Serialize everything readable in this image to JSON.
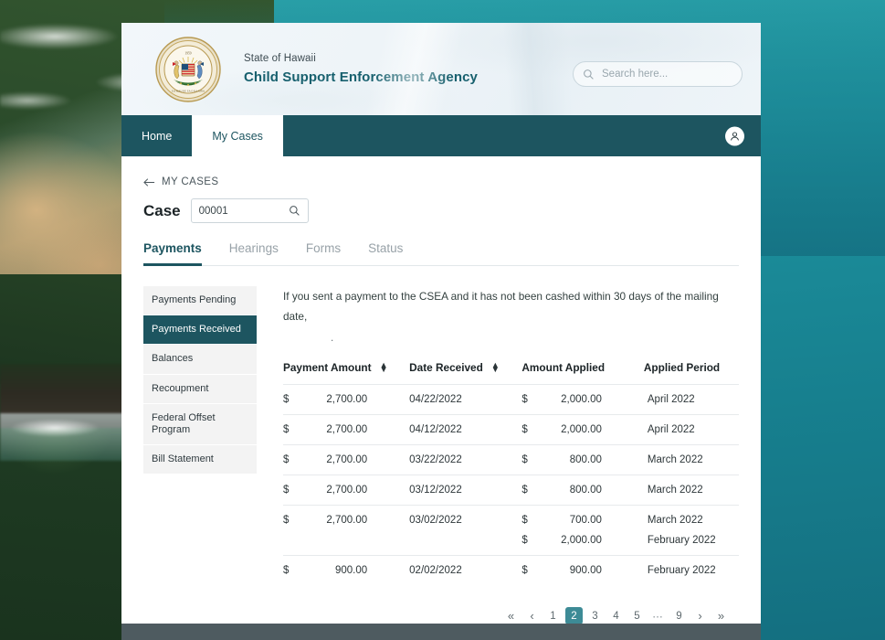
{
  "masthead": {
    "seal_icon": "hawaii-state-seal",
    "agency_state": "State of Hawaii",
    "agency_name": "Child Support Enforcement Agency",
    "search_placeholder": "Search here...",
    "search_icon": "search-icon"
  },
  "navbar": {
    "items": [
      {
        "label": "Home",
        "active": false
      },
      {
        "label": "My Cases",
        "active": true
      }
    ],
    "avatar_icon": "user-avatar-icon"
  },
  "breadcrumb": {
    "back_icon": "arrow-left-icon",
    "label": "MY CASES"
  },
  "case": {
    "label": "Case",
    "value": "00001",
    "placeholder": "00001",
    "search_icon": "search-icon"
  },
  "tabs": [
    {
      "label": "Payments",
      "active": true
    },
    {
      "label": "Hearings",
      "active": false
    },
    {
      "label": "Forms",
      "active": false
    },
    {
      "label": "Status",
      "active": false
    }
  ],
  "sidebar": {
    "items": [
      {
        "label": "Payments Pending",
        "active": false
      },
      {
        "label": "Payments Received",
        "active": true
      },
      {
        "label": "Balances",
        "active": false
      },
      {
        "label": "Recoupment",
        "active": false
      },
      {
        "label": "Federal Offset Program",
        "active": false
      },
      {
        "label": "Bill Statement",
        "active": false
      }
    ]
  },
  "main": {
    "notice_line1": "If you sent a payment to the CSEA and it has not been cashed within 30 days of the mailing date,",
    "notice_line2": ".",
    "table": {
      "columns": [
        {
          "label": "Payment Amount",
          "sortable": true,
          "sort_icon": "sort-updown-icon"
        },
        {
          "label": "Date Received",
          "sortable": true,
          "sort_icon": "sort-updown-icon"
        },
        {
          "label": "Amount Applied",
          "sortable": false
        },
        {
          "label": "Applied Period",
          "sortable": false
        }
      ],
      "rows": [
        {
          "currency": "$",
          "payment_amount": "2,700.00",
          "date_received": "04/22/2022",
          "applied_currency": "$",
          "amount_applied": "2,000.00",
          "applied_period": "April 2022"
        },
        {
          "currency": "$",
          "payment_amount": "2,700.00",
          "date_received": "04/12/2022",
          "applied_currency": "$",
          "amount_applied": "2,000.00",
          "applied_period": "April 2022"
        },
        {
          "currency": "$",
          "payment_amount": "2,700.00",
          "date_received": "03/22/2022",
          "applied_currency": "$",
          "amount_applied": "800.00",
          "applied_period": "March 2022"
        },
        {
          "currency": "$",
          "payment_amount": "2,700.00",
          "date_received": "03/12/2022",
          "applied_currency": "$",
          "amount_applied": "800.00",
          "applied_period": "March 2022"
        },
        {
          "currency": "$",
          "payment_amount": "2,700.00",
          "date_received": "03/02/2022",
          "applied_currency": "$",
          "amount_applied": "700.00",
          "applied_period": "March 2022",
          "sub_applied_currency": "$",
          "sub_amount_applied": "2,000.00",
          "sub_applied_period": "February 2022"
        },
        {
          "currency": "$",
          "payment_amount": "900.00",
          "date_received": "02/02/2022",
          "applied_currency": "$",
          "amount_applied": "900.00",
          "applied_period": "February 2022"
        }
      ]
    }
  },
  "pagination": {
    "first_icon": "chevron-double-left-icon",
    "prev_icon": "chevron-left-icon",
    "next_icon": "chevron-right-icon",
    "last_icon": "chevron-double-right-icon",
    "first_label": "«",
    "prev_label": "‹",
    "next_label": "›",
    "last_label": "»",
    "pages": [
      "1",
      "2",
      "3",
      "4",
      "5",
      "⋯",
      "9"
    ],
    "current": "2"
  },
  "colors": {
    "teal_dark": "#1d5560",
    "teal_accent": "#3d8b96",
    "sidebar_bg": "#f3f3f3",
    "footer_bg": "#4e5b60"
  }
}
